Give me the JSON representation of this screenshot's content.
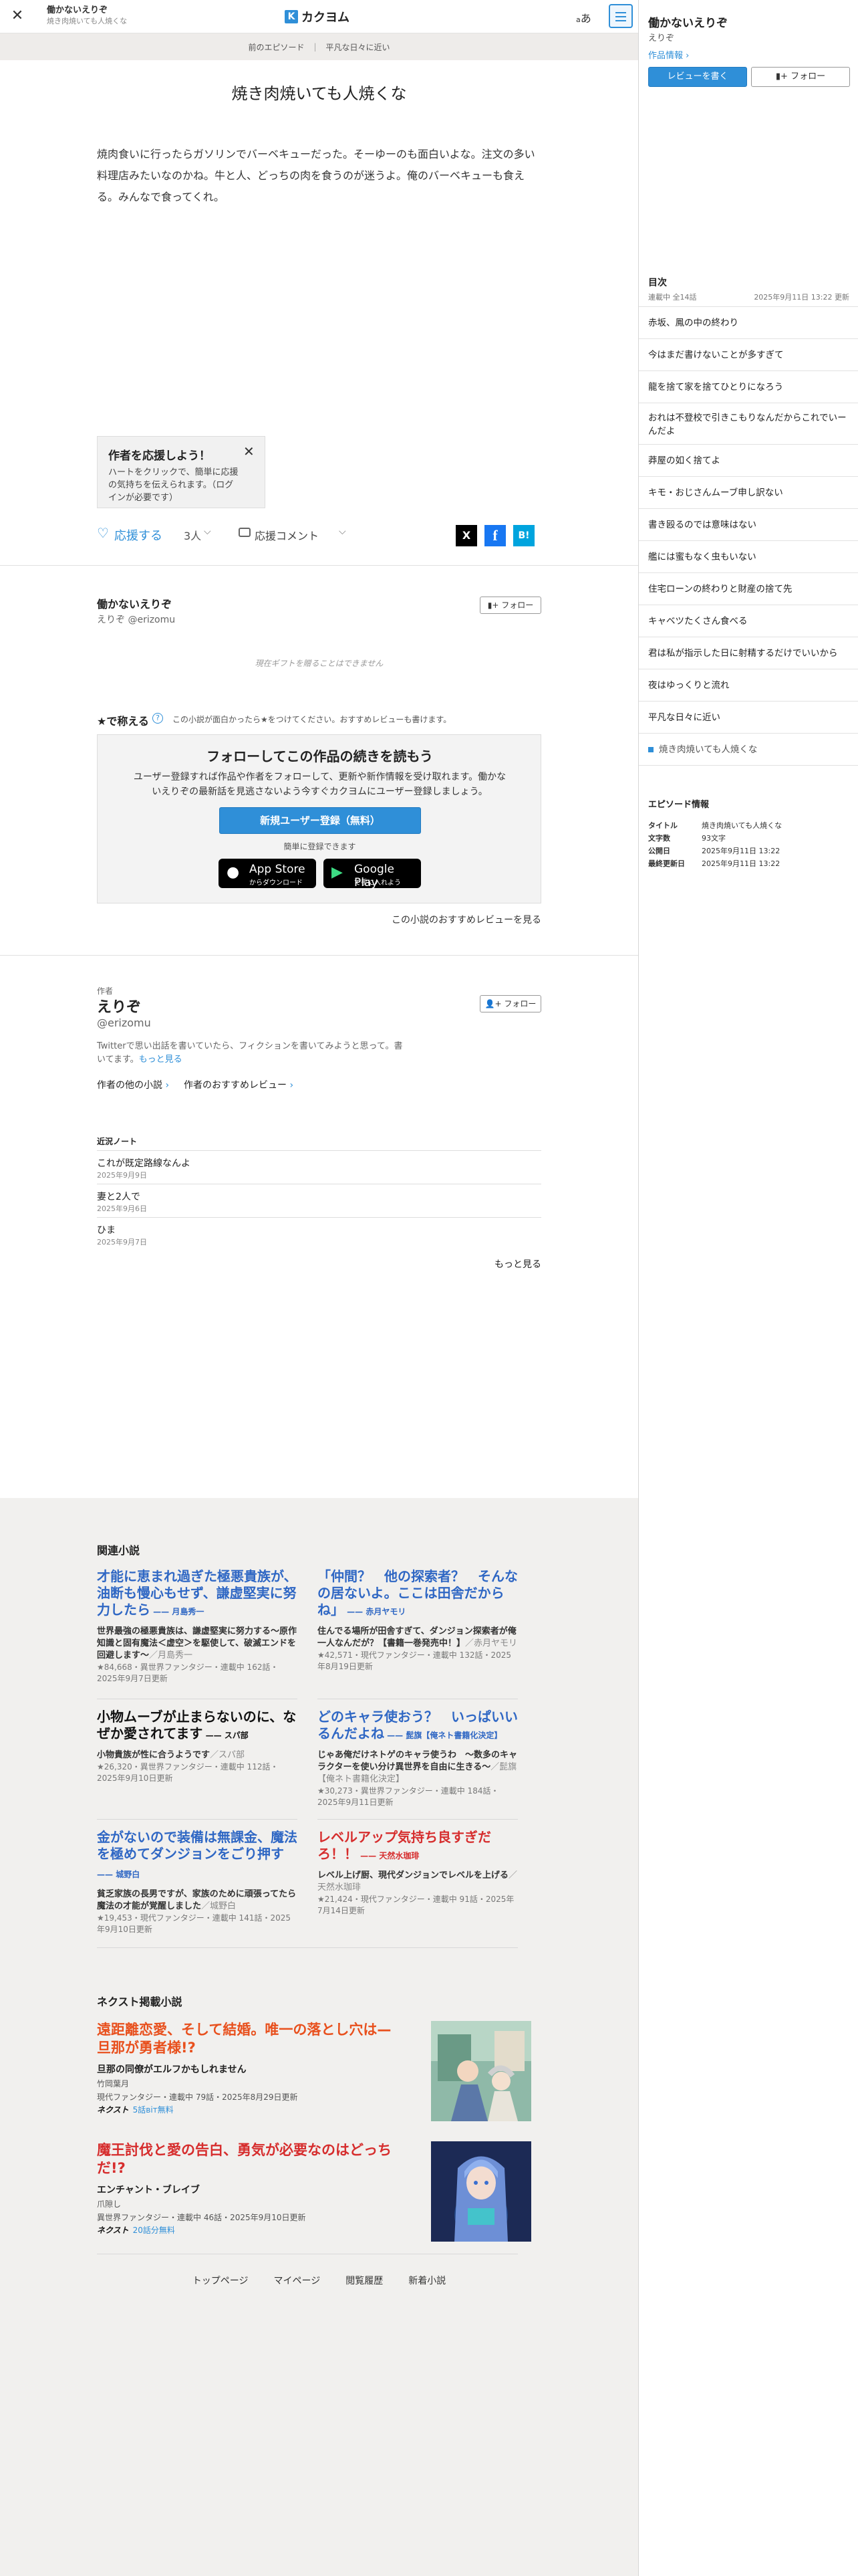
{
  "header": {
    "work_title": "働かないえりぞ",
    "episode_title": "焼き肉焼いても人焼くな",
    "logo_text": "カクヨム",
    "font_toggle": "あ"
  },
  "subnav": {
    "prev": "前のエピソード",
    "next": "平凡な日々に近い"
  },
  "episode": {
    "title": "焼き肉焼いても人焼くな",
    "body": "焼肉食いに行ったらガソリンでバーベキューだった。そーゆーのも面白いよな。注文の多い料理店みたいなのかね。牛と人、どっちの肉を食うのが迷うよ。俺のバーベキューも食える。みんなで食ってくれ。"
  },
  "cheer_popup": {
    "title": "作者を応援しよう！",
    "body": "ハートをクリックで、簡単に応援の気持ちを伝えられます。（ログインが必要です）"
  },
  "cheer": {
    "label": "応援する",
    "count": "3人",
    "comment": "応援コメント"
  },
  "share": {
    "x": "X",
    "facebook": "f",
    "hatena": "B!"
  },
  "author_box": {
    "work": "働かないえりぞ",
    "author": "えりぞ @erizomu",
    "follow": "フォロー",
    "gift_note": "現在ギフトを贈ることはできません"
  },
  "review": {
    "title": "★で称える",
    "help": "?",
    "desc": "この小説が面白かったら★をつけてください。おすすめレビューも書けます。"
  },
  "cta": {
    "title": "フォローしてこの作品の続きを読もう",
    "body": "ユーザー登録すれば作品や作者をフォローして、更新や新作情報を受け取れます。働かないえりぞの最新話を見逃さないよう今すぐカクヨムにユーザー登録しましょう。",
    "register": "新規ユーザー登録（無料）",
    "easy": "簡単に登録できます",
    "appstore_title": "App Store",
    "appstore_sub": "からダウンロード",
    "googleplay_title": "Google Play",
    "googleplay_sub": "で手に入れよう"
  },
  "rec_link": "この小説のおすすめレビューを見る",
  "author": {
    "label": "作者",
    "name": "えりぞ",
    "id": "@erizomu",
    "bio": "Twitterで思い出話を書いていたら、フィクションを書いてみようと思って。書いてます。",
    "bio_more": "もっと見る",
    "other_works": "作者の他の小説",
    "rec_reviews": "作者のおすすめレビュー",
    "follow": "フォロー"
  },
  "notes": {
    "heading": "近況ノート",
    "items": [
      {
        "title": "これが既定路線なんよ",
        "date": "2025年9月9日"
      },
      {
        "title": "妻と2人で",
        "date": "2025年9月6日"
      },
      {
        "title": "ひま",
        "date": "2025年9月7日"
      }
    ],
    "more": "もっと見る"
  },
  "related": {
    "heading": "関連小説",
    "items": [
      {
        "title": "才能に恵まれ過ぎた極悪貴族が、油断も慢心もせず、謙虚堅実に努力したら",
        "author": "月島秀一",
        "desc": "世界最強の極悪貴族は、謙虚堅実に努力する〜原作知識と固有魔法＜虚空＞を駆使して、破滅エンドを回避します〜",
        "desc_author": "／月島秀一",
        "meta": "★84,668・異世界ファンタジー・連載中 162話・2025年9月7日更新"
      },
      {
        "title": "「仲間？　他の探索者？　そんなの居ないよ。ここは田舎だからね」",
        "author": "赤月ヤモリ",
        "desc": "住んでる場所が田舎すぎて、ダンジョン探索者が俺一人なんだが？【書籍一巻発売中！】",
        "desc_author": "／赤月ヤモリ",
        "meta": "★42,571・現代ファンタジー・連載中 132話・2025年8月19日更新"
      },
      {
        "title": "小物ムーブが止まらないのに、なぜか愛されてます",
        "author": "スパ部",
        "desc": "小物貴族が性に合うようです",
        "desc_author": "／スパ部",
        "meta": "★26,320・異世界ファンタジー・連載中 112話・2025年9月10日更新"
      },
      {
        "title": "どのキャラ使おう？　いっぱいいるんだよね",
        "author": "髭旗【俺ネト書籍化決定】",
        "desc": "じゃあ俺だけネトゲのキャラ使うわ　〜数多のキャラクターを使い分け異世界を自由に生きる〜",
        "desc_author": "／髭旗【俺ネト書籍化決定】",
        "meta": "★30,273・異世界ファンタジー・連載中 184話・2025年9月11日更新"
      },
      {
        "title": "金がないので装備は無課金、魔法を極めてダンジョンをごり押す",
        "author": "城野白",
        "desc": "貧乏家族の長男ですが、家族のために頑張ってたら魔法の才能が覚醒しました",
        "desc_author": "／城野白",
        "meta": "★19,453・現代ファンタジー・連載中 141話・2025年9月10日更新"
      },
      {
        "title": "レベルアップ気持ち良すぎだろ！！",
        "author": "天然水珈琲",
        "desc": "レベル上げ厨、現代ダンジョンでレベルを上げる",
        "desc_author": "／天然水珈琲",
        "meta": "★21,424・現代ファンタジー・連載中 91話・2025年7月14日更新"
      }
    ]
  },
  "next_novels": {
    "heading": "ネクスト掲載小説",
    "items": [
      {
        "title": "遠距離恋愛、そして結婚。唯一の落とし穴は—旦那が勇者様!?",
        "sub": "旦那の同僚がエルフかもしれません",
        "author": "竹岡葉月",
        "meta": "現代ファンタジー・連載中 79話・2025年8月29日更新",
        "logo": "ネクスト",
        "free": "5話віт無料"
      },
      {
        "title": "魔王討伐と愛の告白、勇気が必要なのはどっちだ!?",
        "sub": "エンチャント・ブレイブ",
        "author": "爪隙し",
        "meta": "異世界ファンタジー・連載中 46話・2025年9月10日更新",
        "logo": "ネクスト",
        "free": "20話分無料"
      }
    ]
  },
  "footer": {
    "links": [
      "トップページ",
      "マイページ",
      "閲覧履歴",
      "新着小説"
    ]
  },
  "sidebar": {
    "title": "働かないえりぞ",
    "author": "えりぞ",
    "info_link": "作品情報",
    "review_button": "レビューを書く",
    "follow_button": "フォロー",
    "toc_heading": "目次",
    "toc_status": "連載中 全14話",
    "toc_updated": "2025年9月11日 13:22 更新",
    "toc": [
      "赤坂、鳳の中の終わり",
      "今はまだ書けないことが多すぎて",
      "龍を捨て家を捨てひとりになろう",
      "おれは不登校で引きこもりなんだからこれでいーんだよ",
      "莽屋の如く捨てよ",
      "キモ・おじさんムーブ申し訳ない",
      "書き殴るのでは意味はない",
      "艦には蜜もなく虫もいない",
      "住宅ローンの終わりと財産の捨て先",
      "キャベツたくさん食べる",
      "君は私が指示した日に射精するだけでいいから",
      "夜はゆっくりと流れ",
      "平凡な日々に近い",
      "焼き肉焼いても人焼くな"
    ],
    "ep_info_heading": "エピソード情報",
    "ep_info": [
      {
        "k": "タイトル",
        "v": "焼き肉焼いても人焼くな"
      },
      {
        "k": "文字数",
        "v": "93文字"
      },
      {
        "k": "公開日",
        "v": "2025年9月11日 13:22"
      },
      {
        "k": "最終更新日",
        "v": "2025年9月11日 13:22"
      }
    ]
  }
}
